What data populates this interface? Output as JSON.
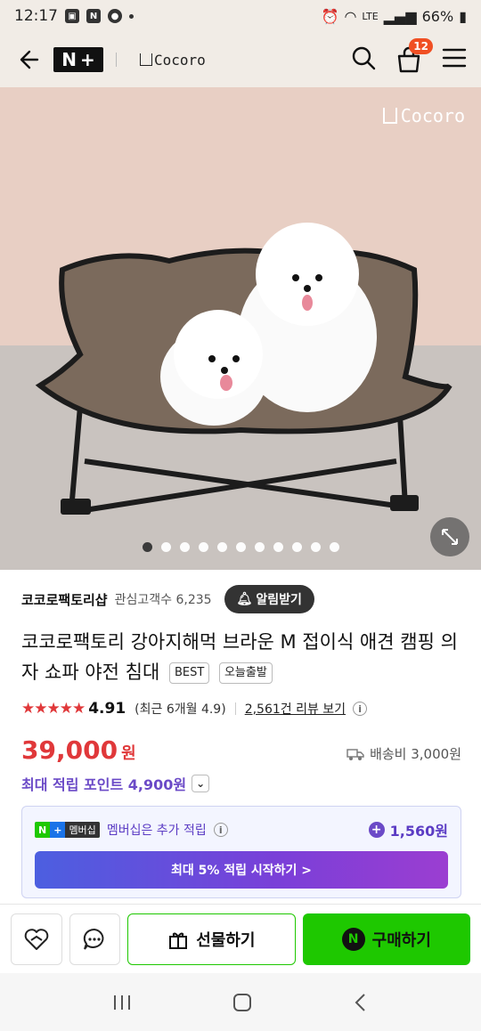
{
  "status_bar": {
    "time": "12:17",
    "battery": "66%",
    "network": "LTE"
  },
  "header": {
    "brand": "Cocoro",
    "cart_count": "12"
  },
  "hero": {
    "watermark": "Cocoro",
    "image_count": 11,
    "active_index": 0
  },
  "shop": {
    "name": "코코로팩토리샵",
    "followers": "관심고객수 6,235",
    "alarm_label": "알림받기"
  },
  "product": {
    "title": "코코로팩토리 강아지해먹 브라운 M 접이식 애견 캠핑 의자 쇼파 야전 침대",
    "tags": [
      "BEST",
      "오늘출발"
    ],
    "rating": "4.91",
    "recent_rating": "(최근 6개월 4.9)",
    "reviews": "2,561건 리뷰 보기",
    "price": "39,000",
    "currency": "원",
    "shipping": "배송비 3,000원",
    "points": "최대 적립 포인트 4,900원"
  },
  "membership": {
    "badge_n": "N",
    "badge_plus": "+",
    "badge_text": "멤버십",
    "text": "멤버십은 추가 적립",
    "reward": "1,560원",
    "cta": "최대 5% 적립 시작하기 >"
  },
  "bottom_bar": {
    "gift": "선물하기",
    "buy": "구매하기"
  },
  "colors": {
    "accent_red": "#e0383a",
    "naver_green": "#1ec800",
    "purple": "#6b4ac7"
  }
}
